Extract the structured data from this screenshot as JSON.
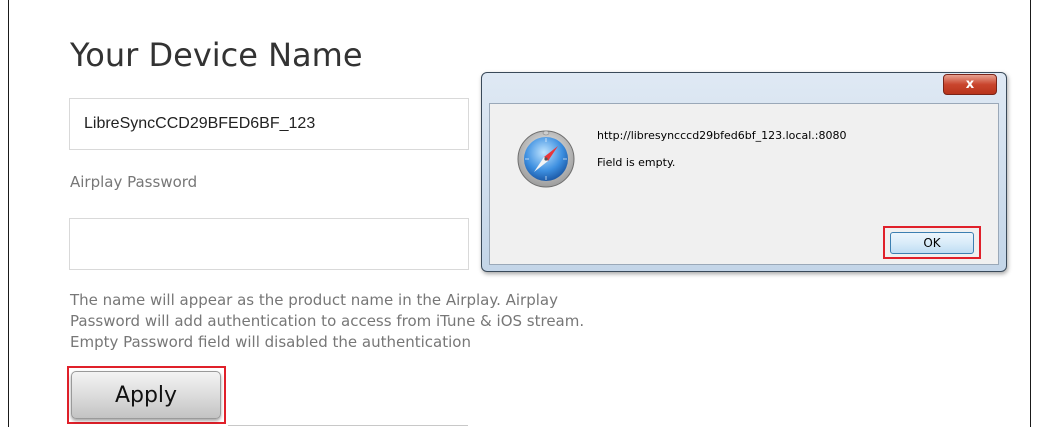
{
  "form": {
    "title": "Your Device Name",
    "device_name_value": "LibreSyncCCD29BFED6BF_123",
    "password_label": "Airplay Password",
    "password_value": "",
    "help_text": "The name will appear as the product name in the Airplay. Airplay Password will add authentication to access from iTune & iOS stream. Empty Password field will disabled the authentication",
    "apply_label": "Apply"
  },
  "dialog": {
    "close_label": "x",
    "url": "http://libresyncccd29bfed6bf_123.local.:8080",
    "message": "Field is empty.",
    "ok_label": "OK",
    "icon": "safari-compass-icon"
  },
  "colors": {
    "highlight": "#e0202a",
    "close_button": "#c9452d",
    "dialog_frame": "#c3d5e8"
  }
}
